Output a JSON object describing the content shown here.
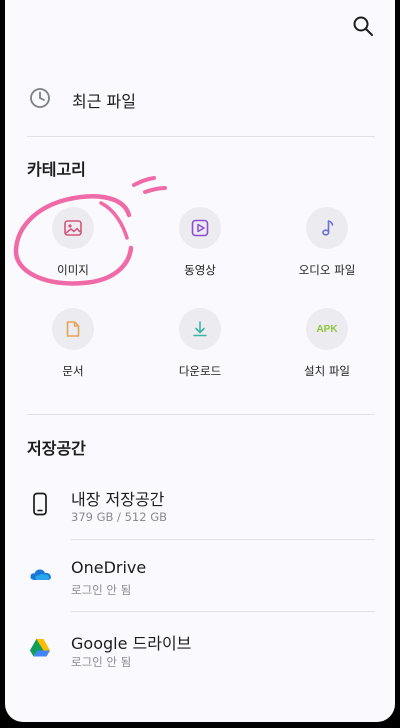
{
  "header": {
    "search_icon": "search-icon"
  },
  "recent": {
    "label": "최근 파일",
    "icon": "clock-icon"
  },
  "categories": {
    "title": "카테고리",
    "items": [
      {
        "label": "이미지",
        "icon": "image-icon",
        "color": "#d4547a"
      },
      {
        "label": "동영상",
        "icon": "video-icon",
        "color": "#8c4fd6"
      },
      {
        "label": "오디오 파일",
        "icon": "music-note-icon",
        "color": "#6b6fd4"
      },
      {
        "label": "문서",
        "icon": "document-icon",
        "color": "#e3a45a"
      },
      {
        "label": "다운로드",
        "icon": "download-icon",
        "color": "#3bb5a8"
      },
      {
        "label": "설치 파일",
        "icon": "apk-icon",
        "badge": "APK",
        "color": "#8dc63f"
      }
    ]
  },
  "storage": {
    "title": "저장공간",
    "items": [
      {
        "title": "내장 저장공간",
        "subtitle": "379 GB / 512 GB",
        "icon": "phone-icon"
      },
      {
        "title": "OneDrive",
        "subtitle": "로그인 안 됨",
        "icon": "onedrive-cloud-icon"
      },
      {
        "title": "Google 드라이브",
        "subtitle": "로그인 안 됨",
        "icon": "google-drive-icon"
      }
    ]
  },
  "colors": {
    "annotation": "#f06aa8",
    "background": "#faf9fd"
  }
}
